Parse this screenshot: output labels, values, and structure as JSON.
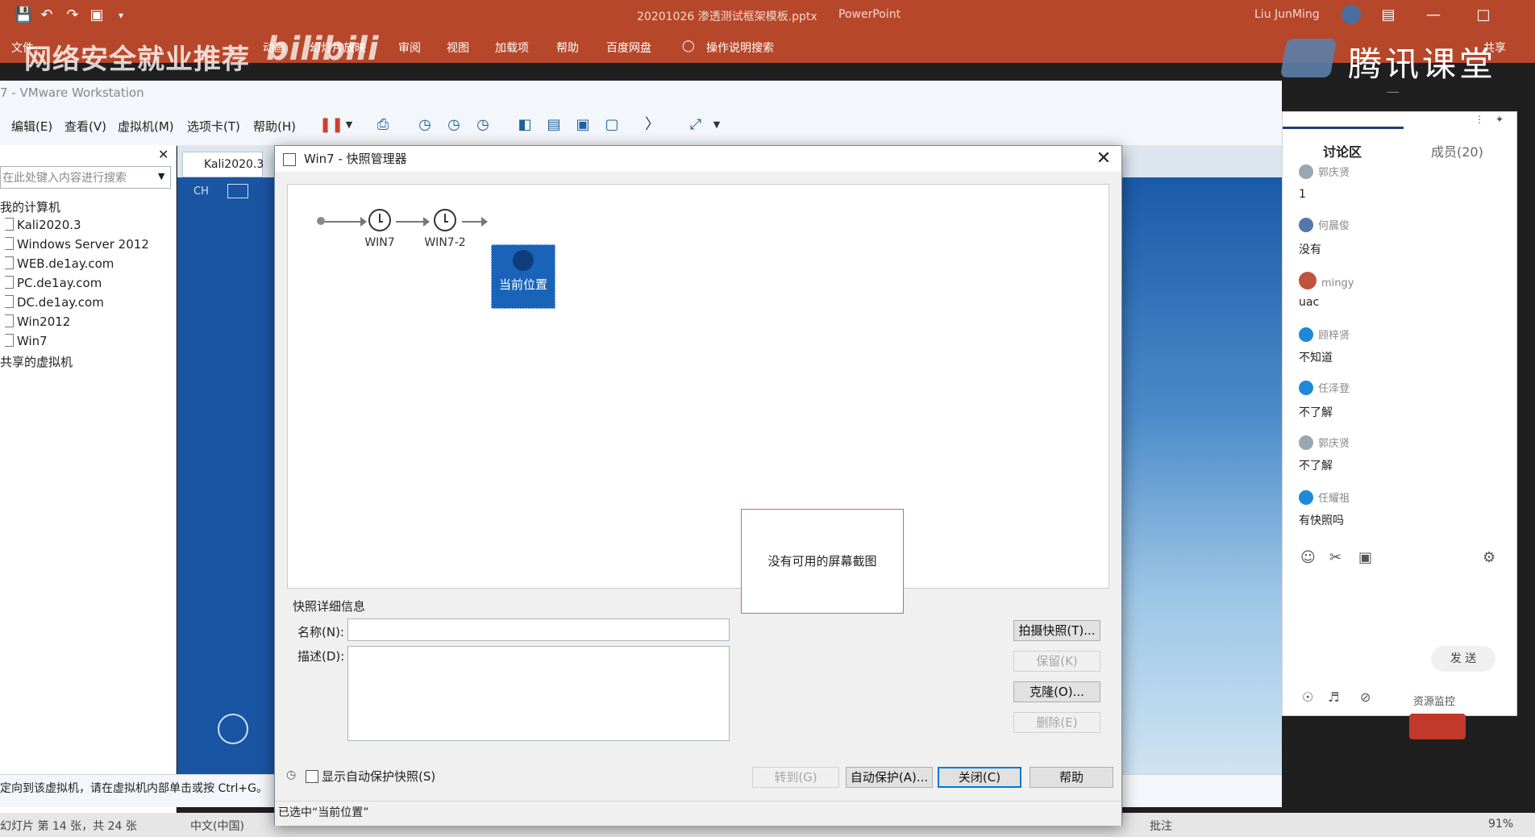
{
  "ppt": {
    "filename": "20201026 渗透测试框架模板.pptx",
    "app": "PowerPoint",
    "user": "Liu JunMing",
    "share": "共享",
    "tabs": [
      "文件",
      "审阅",
      "视图",
      "加载项",
      "帮助",
      "百度网盘",
      "操作说明搜索"
    ],
    "tab_partial": [
      "动画",
      "幻灯片放映"
    ],
    "status_slide": "幻灯片 第 14 张，共 24 张",
    "status_lang": "中文(中国)",
    "status_note": "批注",
    "zoom": "91%"
  },
  "watermark": {
    "text": "网络安全就业推荐",
    "bili": "bilibili",
    "tencent": "腾讯课堂"
  },
  "vmware": {
    "title": "7 - VMware Workstation",
    "menus": [
      "编辑(E)",
      "查看(V)",
      "虚拟机(M)",
      "选项卡(T)",
      "帮助(H)"
    ],
    "search_placeholder": "在此处键入内容进行搜索",
    "tree": [
      "我的计算机",
      "Kali2020.3",
      "Windows Server 2012",
      "WEB.de1ay.com",
      "PC.de1ay.com",
      "DC.de1ay.com",
      "Win2012",
      "Win7",
      "共享的虚拟机"
    ],
    "tab_label": "Kali2020.3",
    "status_hint": "定向到该虚拟机，请在虚拟机内部单击或按 Ctrl+G。"
  },
  "dialog": {
    "title": "Win7 - 快照管理器",
    "snapshots": [
      "WIN7",
      "WIN7-2"
    ],
    "current_label": "当前位置",
    "details_heading": "快照详细信息",
    "name_label": "名称(N):",
    "desc_label": "描述(D):",
    "name_value": "",
    "desc_value": "",
    "no_screenshot": "没有可用的屏幕截图",
    "btn_take": "拍摄快照(T)...",
    "btn_keep": "保留(K)",
    "btn_clone": "克隆(O)...",
    "btn_delete": "删除(E)",
    "show_auto_label": "显示自动保护快照(S)",
    "show_auto_checked": false,
    "btn_goto": "转到(G)",
    "btn_autoprotect": "自动保护(A)...",
    "btn_close": "关闭(C)",
    "btn_help": "帮助",
    "status": "已选中“当前位置”"
  },
  "chat": {
    "tab_discuss": "讨论区",
    "tab_members": "成员(20)",
    "messages": [
      {
        "name": "郭庆贤",
        "text": "1",
        "avatar_color": "#9aa6b2"
      },
      {
        "name": "何晨俊",
        "text": "没有",
        "avatar_color": "#5577aa"
      },
      {
        "name": "mingy",
        "text": "uac",
        "avatar_color": "#c0533e"
      },
      {
        "name": "顾梓贤",
        "text": "不知道",
        "avatar_color": "#1f88d8"
      },
      {
        "name": "任泽登",
        "text": "不了解",
        "avatar_color": "#1f88d8"
      },
      {
        "name": "郭庆贤",
        "text": "不了解",
        "avatar_color": "#9aa6b2"
      },
      {
        "name": "任耀祖",
        "text": "有快照吗",
        "avatar_color": "#1f88d8"
      }
    ],
    "send": "发 送",
    "resource_monitor": "资源监控"
  }
}
